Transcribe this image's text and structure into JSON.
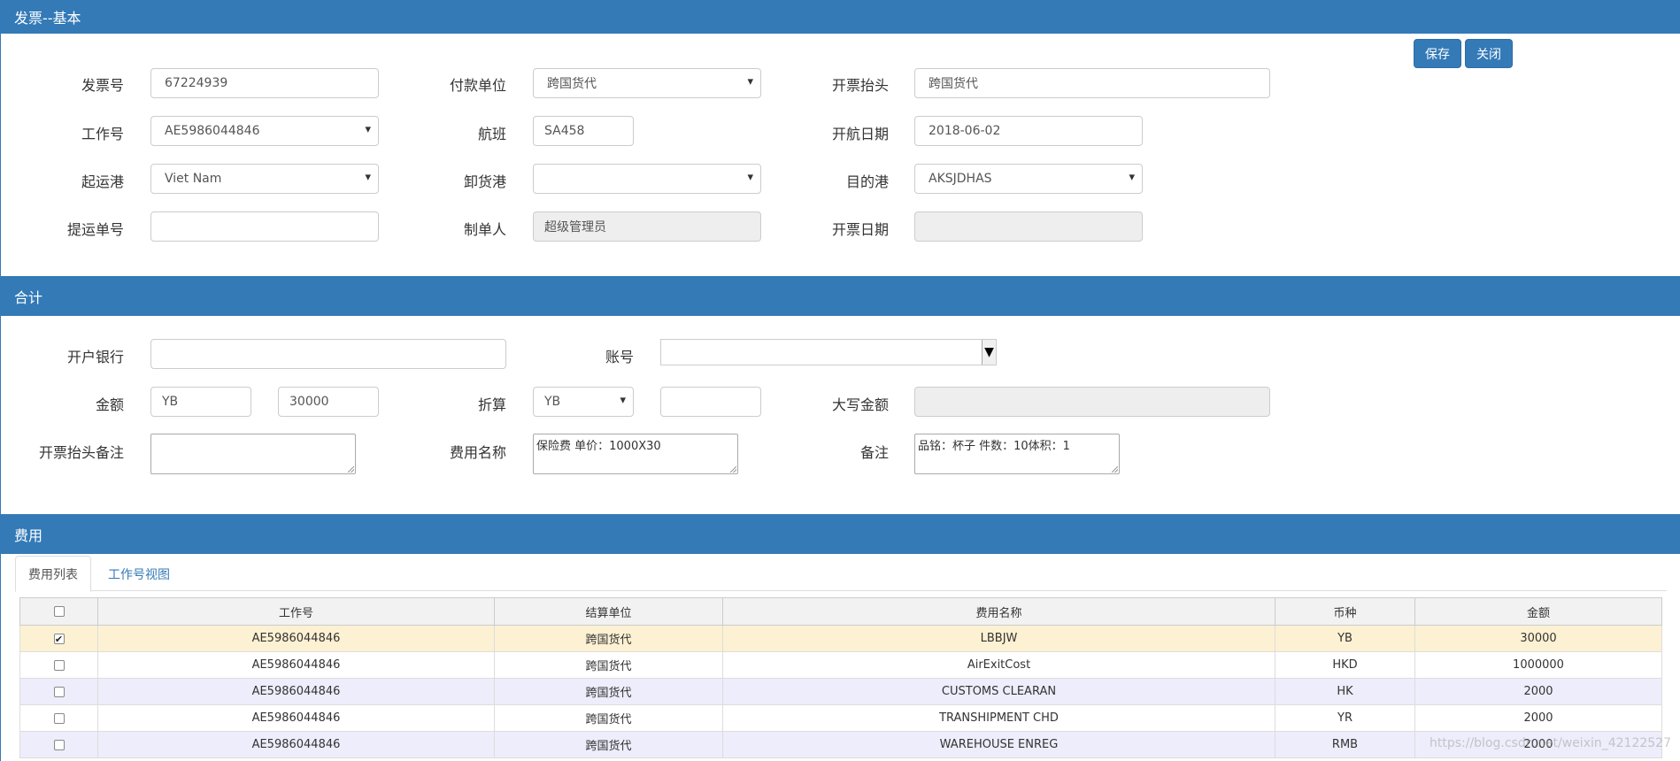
{
  "basic": {
    "title": "发票--基本",
    "buttons": {
      "save": "保存",
      "close": "关闭"
    },
    "invoice_no": {
      "label": "发票号",
      "value": "67224939"
    },
    "payer": {
      "label": "付款单位",
      "value": "跨国货代"
    },
    "invoice_header": {
      "label": "开票抬头",
      "value": "跨国货代"
    },
    "job_no": {
      "label": "工作号",
      "value": "AE5986044846"
    },
    "flight": {
      "label": "航班",
      "value": "SA458"
    },
    "sail_date": {
      "label": "开航日期",
      "value": "2018-06-02"
    },
    "origin_port": {
      "label": "起运港",
      "value": "Viet Nam"
    },
    "discharge_port": {
      "label": "卸货港",
      "value": ""
    },
    "dest_port": {
      "label": "目的港",
      "value": "AKSJDHAS"
    },
    "bl_no": {
      "label": "提运单号",
      "value": ""
    },
    "creator": {
      "label": "制单人",
      "value": "超级管理员"
    },
    "invoice_date": {
      "label": "开票日期",
      "value": ""
    }
  },
  "total": {
    "title": "合计",
    "bank": {
      "label": "开户银行",
      "value": ""
    },
    "account": {
      "label": "账号",
      "value": ""
    },
    "amount": {
      "label": "金额",
      "currency": "YB",
      "value": "30000"
    },
    "convert": {
      "label": "折算",
      "currency": "YB",
      "value": ""
    },
    "amount_words": {
      "label": "大写金额",
      "value": ""
    },
    "header_remark": {
      "label": "开票抬头备注",
      "value": ""
    },
    "fee_name": {
      "label": "费用名称",
      "value": "保险费      单价：1000X30"
    },
    "remark": {
      "label": "备注",
      "value": "品铭：杯子        件数：10体积：1"
    }
  },
  "fees": {
    "title": "费用",
    "tabs": [
      "费用列表",
      "工作号视图"
    ],
    "columns": [
      "工作号",
      "结算单位",
      "费用名称",
      "币种",
      "金额"
    ],
    "rows": [
      {
        "checked": true,
        "job": "AE5986044846",
        "unit": "跨国货代",
        "name": "LBBJW",
        "currency": "YB",
        "amount": "30000"
      },
      {
        "checked": false,
        "job": "AE5986044846",
        "unit": "跨国货代",
        "name": "AirExitCost",
        "currency": "HKD",
        "amount": "1000000"
      },
      {
        "checked": false,
        "job": "AE5986044846",
        "unit": "跨国货代",
        "name": "CUSTOMS CLEARAN",
        "currency": "HK",
        "amount": "2000"
      },
      {
        "checked": false,
        "job": "AE5986044846",
        "unit": "跨国货代",
        "name": "TRANSHIPMENT CHD",
        "currency": "YR",
        "amount": "2000"
      },
      {
        "checked": false,
        "job": "AE5986044846",
        "unit": "跨国货代",
        "name": "WAREHOUSE ENREG",
        "currency": "RMB",
        "amount": "2000"
      }
    ]
  },
  "watermark": "https://blog.csdn.net/weixin_42122527",
  "colors": {
    "header": "#337ab7",
    "selected_row": "#fdf1d3",
    "alt_row": "#ededfb"
  }
}
